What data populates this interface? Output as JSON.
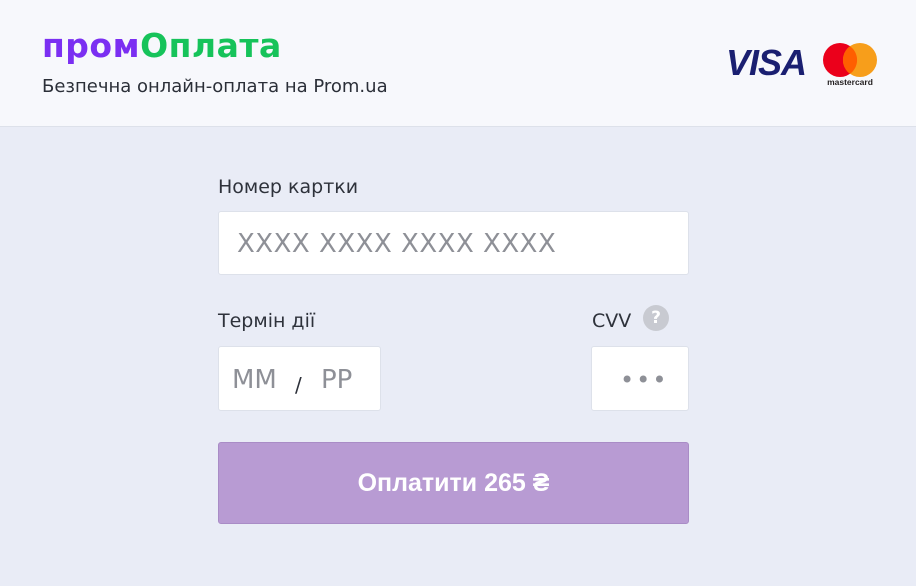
{
  "header": {
    "logo": {
      "part1": "пром",
      "part2": "Оплата",
      "color1": "#7b2ff2",
      "color2": "#16c35a"
    },
    "tagline": "Безпечна онлайн-оплата на Prom.ua",
    "payment_logos": {
      "visa": "VISA",
      "mastercard": "mastercard"
    }
  },
  "form": {
    "card_number": {
      "label": "Номер картки",
      "placeholder": "XXXX XXXX XXXX XXXX"
    },
    "expiry": {
      "label": "Термін дії",
      "month_placeholder": "MM",
      "separator": "/",
      "year_placeholder": "PP"
    },
    "cvv": {
      "label": "CVV",
      "help_icon": "?",
      "placeholder": "•••"
    },
    "pay_button": {
      "label": "Оплатити 265 ₴",
      "color": "#b89bd3"
    }
  }
}
